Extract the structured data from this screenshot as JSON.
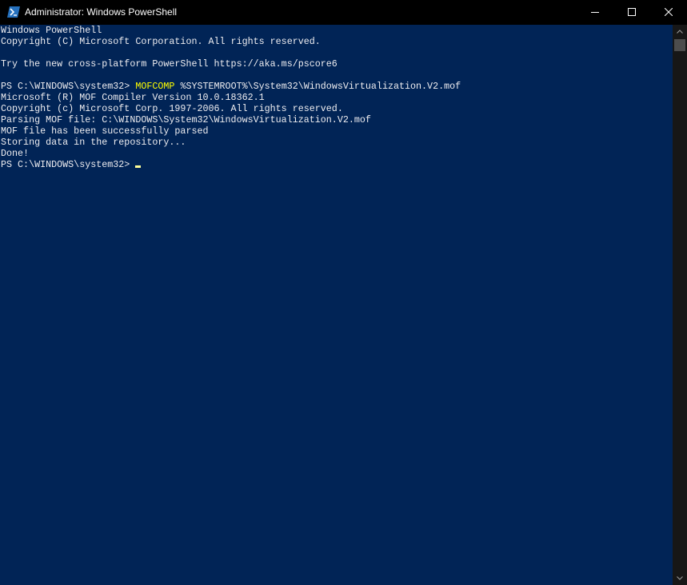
{
  "window": {
    "title": "Administrator: Windows PowerShell"
  },
  "title_controls": {
    "minimize": "minimize-icon",
    "maximize": "maximize-icon",
    "close": "close-icon"
  },
  "console": {
    "colors": {
      "background": "#012456",
      "text": "#eeedf0",
      "command": "#ffff00",
      "cursor": "#fefe99"
    },
    "lines": [
      "Windows PowerShell",
      "Copyright (C) Microsoft Corporation. All rights reserved.",
      "",
      "Try the new cross-platform PowerShell https://aka.ms/pscore6",
      "",
      "",
      "Microsoft (R) MOF Compiler Version 10.0.18362.1",
      "Copyright (c) Microsoft Corp. 1997-2006. All rights reserved.",
      "Parsing MOF file: C:\\WINDOWS\\System32\\WindowsVirtualization.V2.mof",
      "MOF file has been successfully parsed",
      "Storing data in the repository...",
      "Done!"
    ],
    "command_prompt": "PS C:\\WINDOWS\\system32> ",
    "command_name": "MOFCOMP",
    "command_args": " %SYSTEMROOT%\\System32\\WindowsVirtualization.V2.mof",
    "current_prompt": "PS C:\\WINDOWS\\system32>"
  }
}
